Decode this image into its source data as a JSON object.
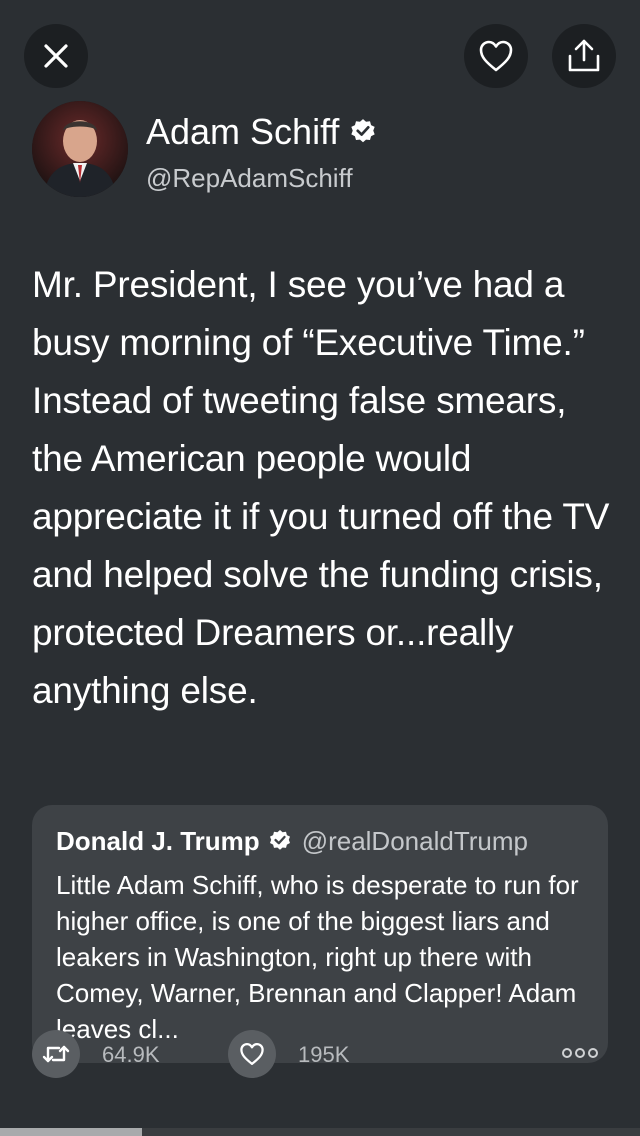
{
  "actions": {
    "close_icon": "close-icon",
    "like_icon": "heart-icon",
    "share_icon": "share-icon"
  },
  "tweet": {
    "author_name": "Adam Schiff",
    "author_handle": "@RepAdamSchiff",
    "verified": true,
    "text": "Mr. President, I see you’ve had a busy morning of “Executive Time.” Instead of tweeting false smears, the American people would appreciate it if you turned off the TV and helped solve the funding crisis, protected Dreamers or...really anything else."
  },
  "quoted_tweet": {
    "author_name": "Donald J. Trump",
    "author_handle": "@realDonaldTrump",
    "verified": true,
    "text": "Little Adam Schiff, who is desperate to run for higher office, is one of the biggest liars and leakers in Washington, right up there with Comey, Warner, Brennan and Clapper! Adam leaves cl..."
  },
  "stats": {
    "retweets": "64.9K",
    "likes": "195K"
  },
  "colors": {
    "background": "#2b2f33",
    "button_bg": "#1c1f22",
    "card_bg": "#3e4246",
    "text_primary": "#ffffff",
    "text_secondary": "#c8cbce"
  },
  "scroll": {
    "position_fraction": 0.22
  }
}
